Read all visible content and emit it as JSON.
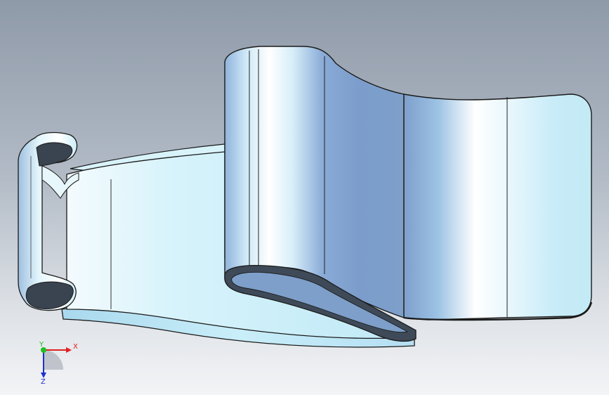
{
  "viewport": {
    "background_top": "#8f9aa9",
    "background_bottom": "#f3f4f6"
  },
  "model": {
    "part_color": "#bfe8f5",
    "highlight_color": "#ffffff",
    "shadow_color": "#7d9fc8",
    "edge_color": "#1a1a1a"
  },
  "triad": {
    "x_label": "X",
    "y_label": "Y",
    "z_label": "Z",
    "x_color": "#e02020",
    "y_color": "#20c020",
    "z_color": "#2030d0"
  }
}
